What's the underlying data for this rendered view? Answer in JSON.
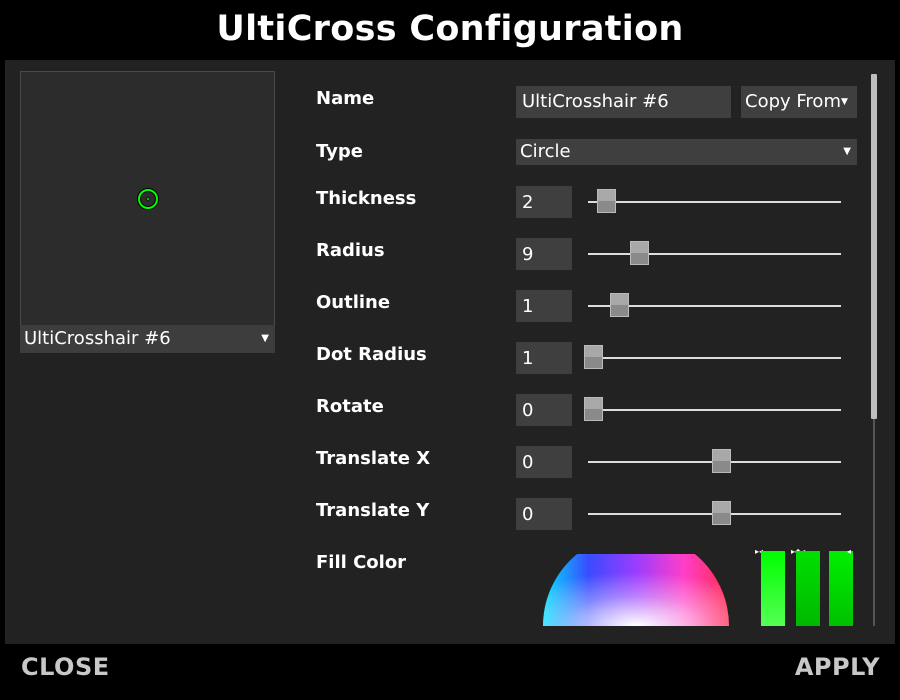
{
  "window": {
    "title": "UltiCross Configuration"
  },
  "preview": {
    "preset_selected": "UltiCrosshair #6",
    "crosshair_color": "#00ff00"
  },
  "fields": {
    "name": {
      "label": "Name",
      "value": "UltiCrosshair #6"
    },
    "copy_from": {
      "label": "Copy From"
    },
    "type": {
      "label": "Type",
      "value": "Circle"
    },
    "thickness": {
      "label": "Thickness",
      "value": "2",
      "slider_fraction": 0.05
    },
    "radius": {
      "label": "Radius",
      "value": "9",
      "slider_fraction": 0.18
    },
    "outline": {
      "label": "Outline",
      "value": "1",
      "slider_fraction": 0.1
    },
    "dot_radius": {
      "label": "Dot Radius",
      "value": "1",
      "slider_fraction": 0.0
    },
    "rotate": {
      "label": "Rotate",
      "value": "0",
      "slider_fraction": 0.0
    },
    "translate_x": {
      "label": "Translate X",
      "value": "0",
      "slider_fraction": 0.5
    },
    "translate_y": {
      "label": "Translate Y",
      "value": "0",
      "slider_fraction": 0.5
    },
    "fill_color": {
      "label": "Fill Color"
    }
  },
  "footer": {
    "close_label": "CLOSE",
    "apply_label": "APPLY"
  },
  "colors": {
    "panel_bg": "#222222",
    "input_bg": "#3f3f3f",
    "accent": "#00ff00"
  }
}
